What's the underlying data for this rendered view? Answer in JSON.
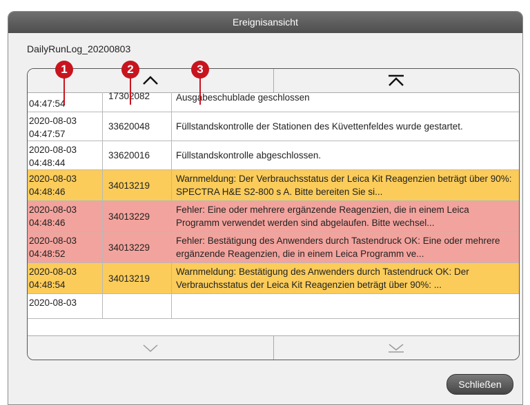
{
  "window": {
    "title": "Ereignisansicht"
  },
  "log_name": "DailyRunLog_20200803",
  "rows": [
    {
      "date": "",
      "time": "04:47:54",
      "code": "17302082",
      "message": "Ausgabeschublade geschlossen",
      "status": "normal"
    },
    {
      "date": "2020-08-03",
      "time": "04:47:57",
      "code": "33620048",
      "message": "Füllstandskontrolle der Stationen des Küvettenfeldes wurde gestartet.",
      "status": "normal"
    },
    {
      "date": "2020-08-03",
      "time": "04:48:44",
      "code": "33620016",
      "message": "Füllstandskontrolle abgeschlossen.",
      "status": "normal"
    },
    {
      "date": "2020-08-03",
      "time": "04:48:46",
      "code": "34013219",
      "message": "Warnmeldung: Der Verbrauchsstatus der Leica Kit Reagenzien beträgt über 90%: SPECTRA H&E S2-800 s A. Bitte bereiten Sie si...",
      "status": "warning"
    },
    {
      "date": "2020-08-03",
      "time": "04:48:46",
      "code": "34013229",
      "message": "Fehler: Eine oder mehrere ergänzende Reagenzien, die in einem Leica Programm verwendet werden sind abgelaufen. Bitte wechsel...",
      "status": "error"
    },
    {
      "date": "2020-08-03",
      "time": "04:48:52",
      "code": "34013229",
      "message": "Fehler: Bestätigung des Anwenders durch Tastendruck OK: Eine oder mehrere ergänzende Reagenzien, die in einem Leica Programm ve...",
      "status": "error"
    },
    {
      "date": "2020-08-03",
      "time": "04:48:54",
      "code": "34013219",
      "message": "Warnmeldung: Bestätigung des Anwenders durch Tastendruck OK: Der Verbrauchsstatus der Leica Kit Reagenzien beträgt über 90%: ...",
      "status": "warning"
    },
    {
      "date": "2020-08-03",
      "time": "",
      "code": "",
      "message": "",
      "status": "normal"
    }
  ],
  "scroll": {
    "up": "chevron-up-icon",
    "top": "chevron-up-bar-icon",
    "down": "chevron-down-icon",
    "bottom": "chevron-down-bar-icon"
  },
  "close_label": "Schließen",
  "callouts": [
    "1",
    "2",
    "3"
  ],
  "colors": {
    "warning": "#fbcc5a",
    "error": "#f3a39d",
    "callout": "#c8141e"
  }
}
